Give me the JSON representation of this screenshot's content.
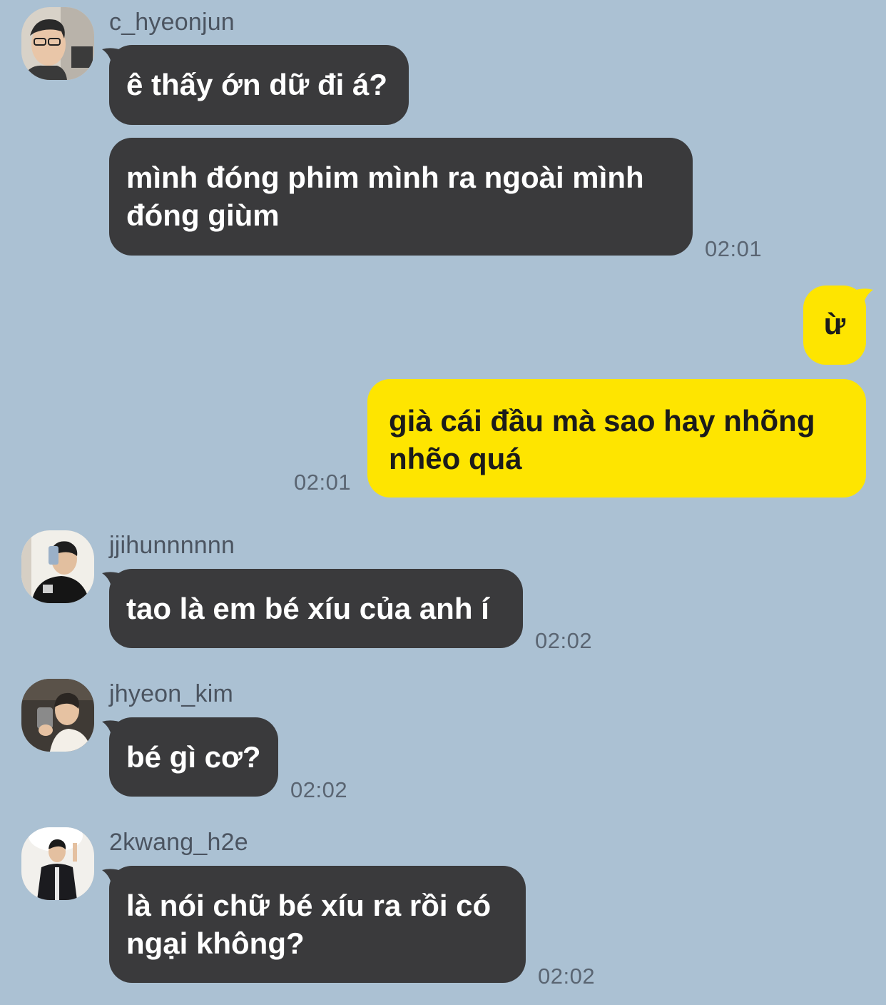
{
  "messages": [
    {
      "sender": "c_hyeonjun",
      "avatar": "avatar-c-hyeonjun",
      "bubbles": [
        "ê thấy ớn dữ đi á?",
        "mình đóng phim mình ra ngoài mình đóng giùm"
      ],
      "time": "02:01"
    },
    {
      "sender": "me",
      "bubbles": [
        "ừ",
        "già cái đầu mà sao hay nhõng nhẽo quá"
      ],
      "time": "02:01"
    },
    {
      "sender": "jjihunnnnnn",
      "avatar": "avatar-jjihunnnnnn",
      "bubbles": [
        "tao là em bé xíu của anh í"
      ],
      "time": "02:02"
    },
    {
      "sender": "jhyeon_kim",
      "avatar": "avatar-jhyeon-kim",
      "bubbles": [
        "bé gì cơ?"
      ],
      "time": "02:02"
    },
    {
      "sender": "2kwang_h2e",
      "avatar": "avatar-2kwang-h2e",
      "bubbles": [
        "là nói chữ bé xíu ra rồi có ngại không?"
      ],
      "time": "02:02"
    }
  ],
  "colors": {
    "background": "#abc1d3",
    "incoming_bubble": "#3a3a3c",
    "outgoing_bubble": "#fee500"
  }
}
